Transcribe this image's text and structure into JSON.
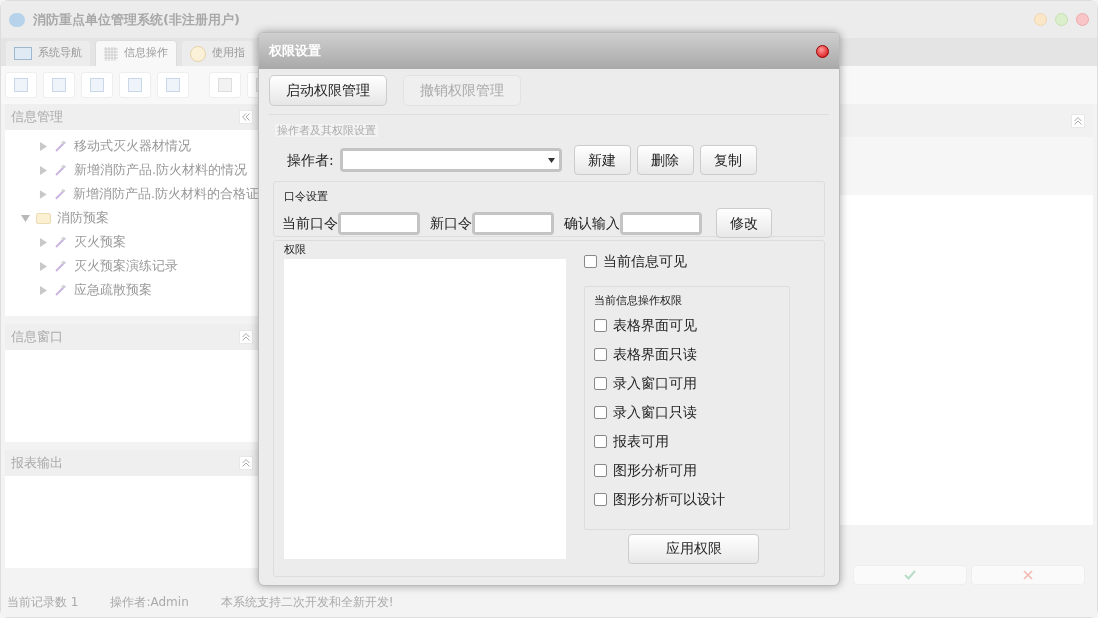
{
  "window": {
    "title": "消防重点单位管理系统(非注册用户)"
  },
  "tabs": [
    {
      "label": "系统导航",
      "selected": false,
      "kind": "monitor"
    },
    {
      "label": "信息操作",
      "selected": true,
      "kind": "grid"
    },
    {
      "label": "使用指",
      "selected": false,
      "kind": "clock"
    }
  ],
  "left_panels": [
    {
      "title": "信息管理",
      "kind": "tree",
      "tree": [
        {
          "label": "移动式灭火器材情况",
          "kind": "item"
        },
        {
          "label": "新增消防产品.防火材料的情况",
          "kind": "item"
        },
        {
          "label": "新增消防产品.防火材料的合格证",
          "kind": "item"
        },
        {
          "label": "消防预案",
          "kind": "folder",
          "expanded": true,
          "children": [
            {
              "label": "灭火预案",
              "kind": "item"
            },
            {
              "label": "灭火预案演练记录",
              "kind": "item"
            },
            {
              "label": "应急疏散预案",
              "kind": "item"
            }
          ]
        }
      ]
    },
    {
      "title": "信息窗口",
      "kind": "blank"
    },
    {
      "title": "报表输出",
      "kind": "blank"
    }
  ],
  "status_bar": [
    "当前记录数 1",
    "操作者:Admin",
    "本系统支持二次开发和全新开发!"
  ],
  "dialog": {
    "title": "权限设置",
    "top_buttons": [
      {
        "label": "启动权限管理",
        "disabled": false
      },
      {
        "label": "撤销权限管理",
        "disabled": true
      }
    ],
    "operator_group": {
      "legend": "操作者及其权限设置",
      "label": "操作者:",
      "buttons": [
        "新建",
        "删除",
        "复制"
      ]
    },
    "password_group": {
      "legend": "口令设置",
      "fields": [
        "当前口令",
        "新口令",
        "确认输入"
      ],
      "button": "修改"
    },
    "permissions": {
      "legend": "权限",
      "visible_checkbox": {
        "label": "当前信息可见",
        "checked": false
      },
      "ops_legend": "当前信息操作权限",
      "ops": [
        {
          "label": "表格界面可见",
          "checked": false
        },
        {
          "label": "表格界面只读",
          "checked": false
        },
        {
          "label": "录入窗口可用",
          "checked": false
        },
        {
          "label": "录入窗口只读",
          "checked": false
        },
        {
          "label": "报表可用",
          "checked": false
        },
        {
          "label": "图形分析可用",
          "checked": false
        },
        {
          "label": "图形分析可以设计",
          "checked": false
        }
      ],
      "apply_button": "应用权限"
    }
  }
}
